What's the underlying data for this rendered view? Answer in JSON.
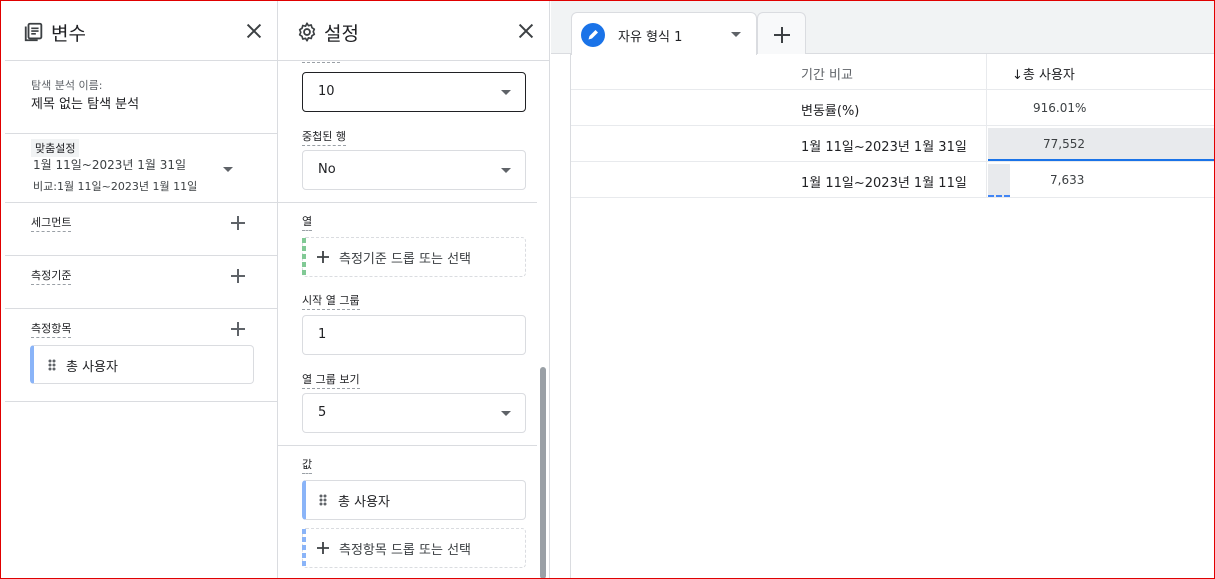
{
  "variables_panel": {
    "title": "변수",
    "exploration_name_label": "탐색 분석 이름:",
    "exploration_name": "제목 없는 탐색 분석",
    "date_label": "맞춤설정",
    "date_range": "1월 11일~2023년 1월 31일",
    "date_compare": "비교:1월 11일~2023년 1월 11일",
    "segments_label": "세그먼트",
    "dimensions_label": "측정기준",
    "metrics_label": "측정항목",
    "metrics": [
      "총 사용자"
    ]
  },
  "settings_panel": {
    "title": "설정",
    "rows_shown_value": "10",
    "nested_rows_label": "중첩된 행",
    "nested_rows_value": "No",
    "columns_label": "열",
    "columns_drop": "측정기준 드롭 또는 선택",
    "start_column_group_label": "시작 열 그룹",
    "start_column_group_value": "1",
    "show_column_groups_label": "열 그룹 보기",
    "show_column_groups_value": "5",
    "values_label": "값",
    "value_chip": "총 사용자",
    "values_drop": "측정항목 드롭 또는 선택"
  },
  "tabs": {
    "tab1_label": "자유 형식 1"
  },
  "table": {
    "header_dim": "기간 비교",
    "header_metric": "↓총 사용자",
    "rows": [
      {
        "label": "변동률(%)",
        "value": "916.01%"
      },
      {
        "label": "1월 11일~2023년 1월 31일",
        "value": "77,552",
        "bar_fraction": 1.0
      },
      {
        "label": "1월 11일~2023년 1월 11일",
        "value": "7,633",
        "bar_fraction": 0.098
      }
    ]
  },
  "colors": {
    "accent": "#1a73e8",
    "metric_chip_bar": "#8ab4f8",
    "dimension_bar": "#81c995"
  },
  "icons": [
    "variables-icon",
    "close-icon",
    "gear-icon",
    "plus-icon",
    "drag-handle-icon",
    "pencil-icon",
    "dropdown-arrow-icon"
  ]
}
